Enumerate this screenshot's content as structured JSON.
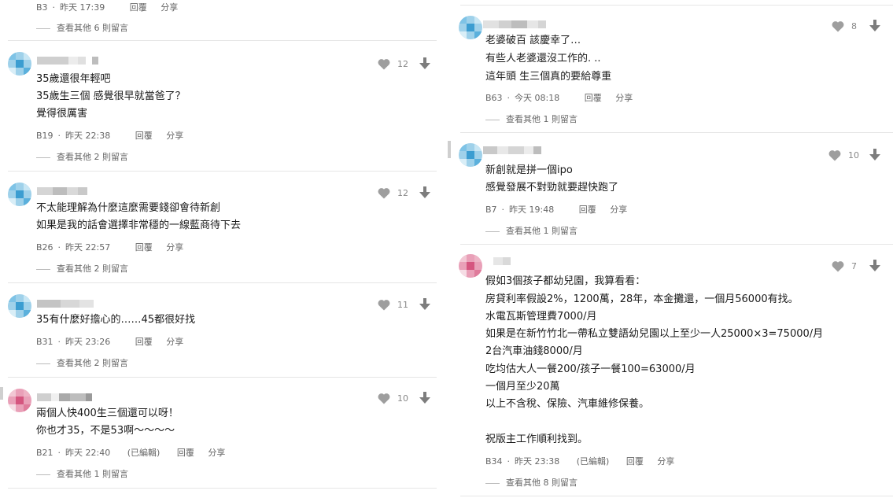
{
  "left": {
    "top_item": {
      "floor": "B3",
      "time": "昨天 17:39",
      "reply": "回覆",
      "share": "分享",
      "more": "查看其他 6 則留言"
    },
    "comments": [
      {
        "avatar": "blue",
        "likes": "12",
        "lines": [
          "35歲還很年輕吧",
          "35歲生三個 感覺很早就當爸了？",
          "覺得很厲害"
        ],
        "floor": "B19",
        "time": "昨天 22:38",
        "edited": "",
        "reply": "回覆",
        "share": "分享",
        "more": "查看其他 2 則留言"
      },
      {
        "avatar": "blue",
        "likes": "12",
        "lines": [
          "不太能理解為什麼這麼需要錢卻會待新創",
          "如果是我的話會選擇非常穩的一線藍商待下去"
        ],
        "floor": "B26",
        "time": "昨天 22:57",
        "edited": "",
        "reply": "回覆",
        "share": "分享",
        "more": "查看其他 2 則留言"
      },
      {
        "avatar": "blue",
        "likes": "11",
        "lines": [
          "35有什麼好擔心的……45都很好找"
        ],
        "floor": "B31",
        "time": "昨天 23:26",
        "edited": "",
        "reply": "回覆",
        "share": "分享",
        "more": "查看其他 2 則留言"
      },
      {
        "avatar": "pink",
        "likes": "10",
        "lines": [
          "兩個人快400生三個還可以呀！",
          "你也才35，不是53啊～～～～"
        ],
        "floor": "B21",
        "time": "昨天 22:40",
        "edited": "(已編輯)",
        "reply": "回覆",
        "share": "分享",
        "more": "查看其他 1 則留言"
      }
    ]
  },
  "right": {
    "comments": [
      {
        "avatar": "blue",
        "likes": "8",
        "lines": [
          "老婆破百 該慶幸了…",
          "有些人老婆還沒工作的. ..",
          "這年頭 生三個真的要給尊重 "
        ],
        "floor": "B63",
        "time": "今天 08:18",
        "edited": "",
        "reply": "回覆",
        "share": "分享",
        "more": "查看其他 1 則留言"
      },
      {
        "avatar": "blue",
        "likes": "10",
        "lines": [
          "新創就是拼一個ipo",
          "感覺發展不對勁就要趕快跑了"
        ],
        "floor": "B7",
        "time": "昨天 19:48",
        "edited": "",
        "reply": "回覆",
        "share": "分享",
        "more": "查看其他 1 則留言"
      },
      {
        "avatar": "pink",
        "likes": "7",
        "lines": [
          "假如3個孩子都幼兒園，我算看看：",
          "房貸利率假設2%，1200萬，28年，本金攤還，一個月56000有找。",
          "水電瓦斯管理費7000/月",
          "如果是在新竹竹北一帶私立雙語幼兒園以上至少一人25000×3=75000/月",
          "2台汽車油錢8000/月",
          "吃均估大人一餐200/孩子一餐100=63000/月",
          "一個月至少20萬",
          "以上不含稅、保險、汽車維修保養。",
          "",
          "祝版主工作順利找到。"
        ],
        "floor": "B34",
        "time": "昨天 23:38",
        "edited": "(已編輯)",
        "reply": "回覆",
        "share": "分享",
        "more": "查看其他 8 則留言"
      }
    ]
  },
  "icons": {
    "like": "heart-icon",
    "dislike": "down-arrow-icon",
    "avatar": "avatar"
  },
  "colors": {
    "text": "#1a1a1a",
    "meta": "#666666",
    "icon": "#9e9e9e",
    "divider": "#e6e6e6"
  }
}
